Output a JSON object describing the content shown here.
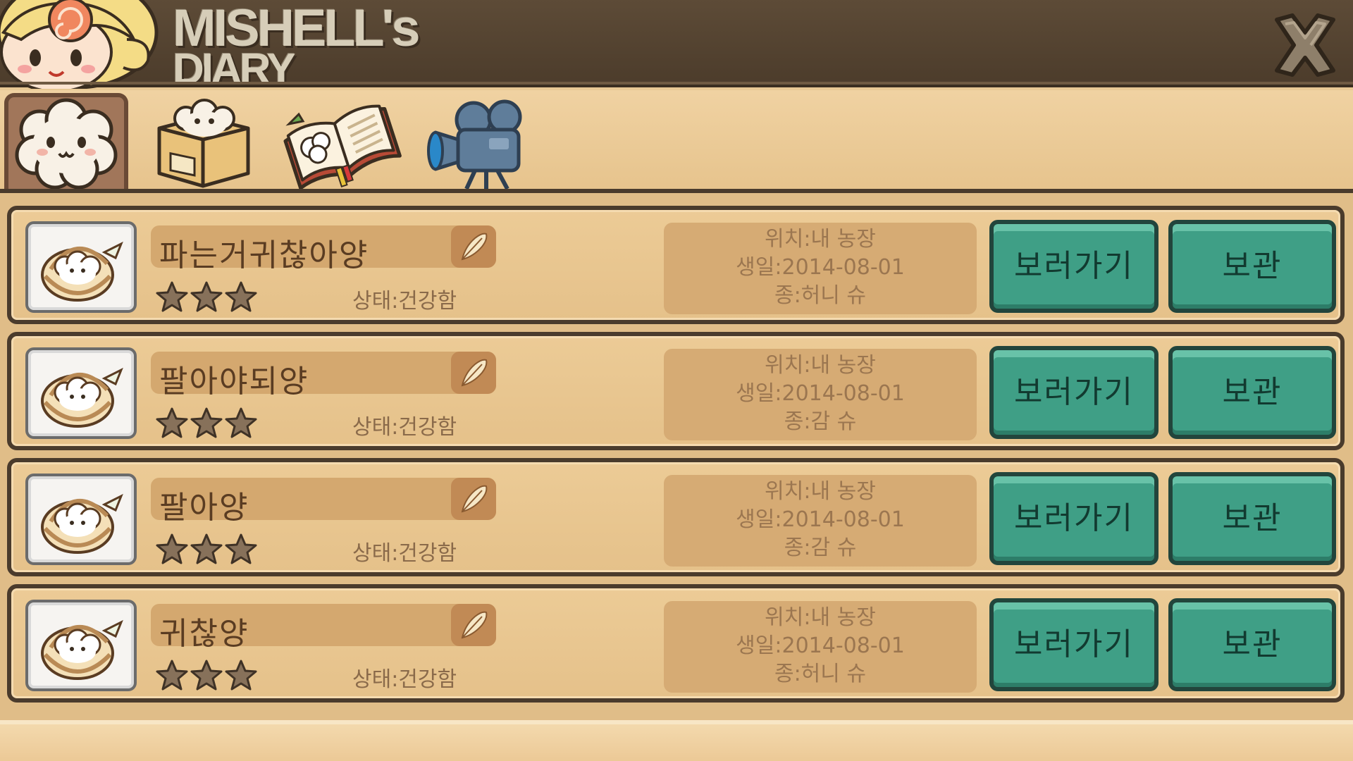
{
  "header": {
    "logo_line1": "MISHELL's",
    "logo_line2": "DIARY"
  },
  "tabs": [
    {
      "icon": "sheep-face-icon",
      "active": true
    },
    {
      "icon": "sheep-box-icon",
      "active": false
    },
    {
      "icon": "diary-book-icon",
      "active": false
    },
    {
      "icon": "video-camera-icon",
      "active": false
    }
  ],
  "rows": [
    {
      "name": "파는거귀찮아양",
      "stars": 3,
      "status": "상태:건강함",
      "location": "위치:내 농장",
      "birthday": "생일:2014-08-01",
      "species": "종:허니 슈",
      "view_label": "보러가기",
      "store_label": "보관"
    },
    {
      "name": "팔아야되양",
      "stars": 3,
      "status": "상태:건강함",
      "location": "위치:내 농장",
      "birthday": "생일:2014-08-01",
      "species": "종:감 슈",
      "view_label": "보러가기",
      "store_label": "보관"
    },
    {
      "name": "팔아양",
      "stars": 3,
      "status": "상태:건강함",
      "location": "위치:내 농장",
      "birthday": "생일:2014-08-01",
      "species": "종:감 슈",
      "view_label": "보러가기",
      "store_label": "보관"
    },
    {
      "name": "귀찮양",
      "stars": 3,
      "status": "상태:건강함",
      "location": "위치:내 농장",
      "birthday": "생일:2014-08-01",
      "species": "종:허니 슈",
      "view_label": "보러가기",
      "store_label": "보관"
    }
  ],
  "colors": {
    "header_bg": "#4c3c2b",
    "panel_bg": "#e8c894",
    "button_green": "#3f9f86",
    "text_brown": "#5a3c22"
  }
}
